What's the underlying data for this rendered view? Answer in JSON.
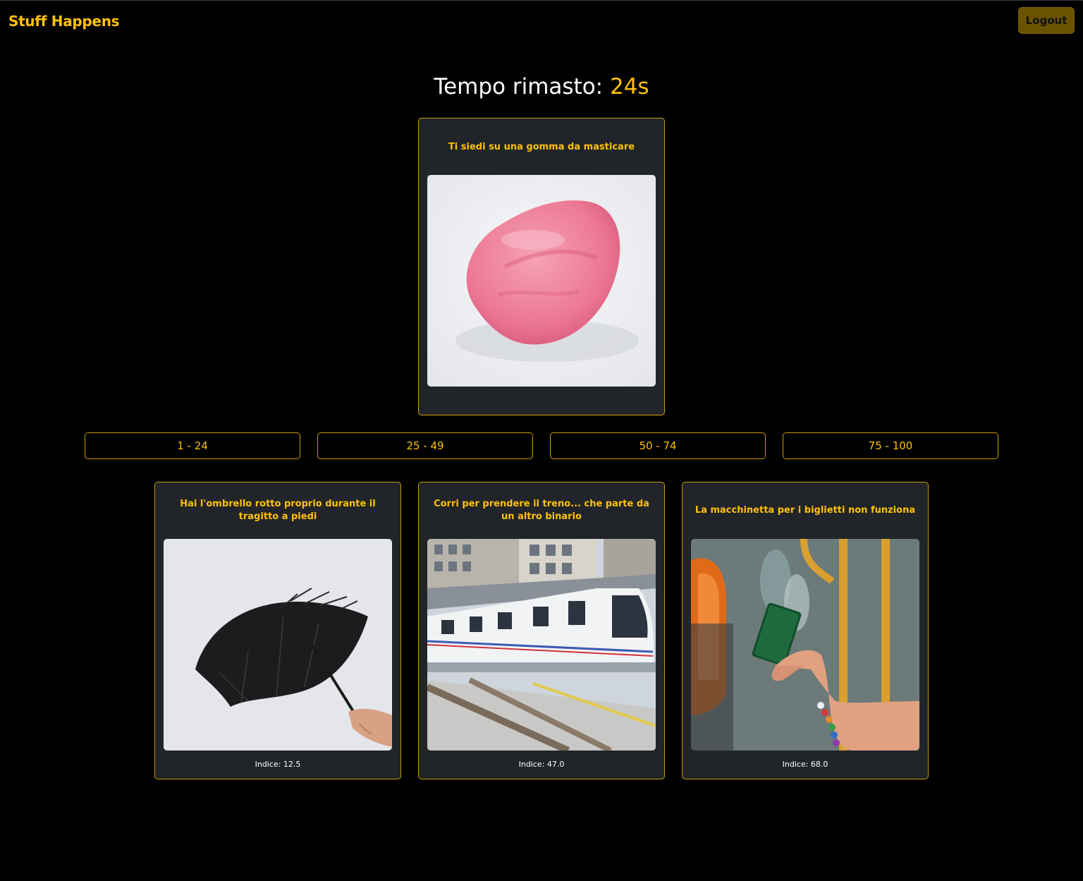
{
  "navbar": {
    "brand": "Stuff Happens",
    "logout_label": "Logout"
  },
  "timer": {
    "label": "Tempo rimasto:",
    "seconds": "24s"
  },
  "current_card": {
    "title": "Ti siedi su una gomma da masticare",
    "image": "chewing-gum-image"
  },
  "range_buttons": [
    {
      "label": "1 - 24"
    },
    {
      "label": "25 - 49"
    },
    {
      "label": "50 - 74"
    },
    {
      "label": "75 - 100"
    }
  ],
  "hand_cards": [
    {
      "title": "Hai l'ombrello rotto proprio durante il tragitto a piedi",
      "index": "Indice: 12.5",
      "image": "broken-umbrella-image"
    },
    {
      "title": "Corri per prendere il treno... che parte da un altro binario",
      "index": "Indice: 47.0",
      "image": "train-image"
    },
    {
      "title": "La macchinetta per i biglietti non funziona",
      "index": "Indice: 68.0",
      "image": "ticket-machine-image"
    }
  ],
  "colors": {
    "accent": "#ffc107",
    "card_bg": "#212529",
    "border": "#c99a06",
    "page_bg": "#000000"
  }
}
